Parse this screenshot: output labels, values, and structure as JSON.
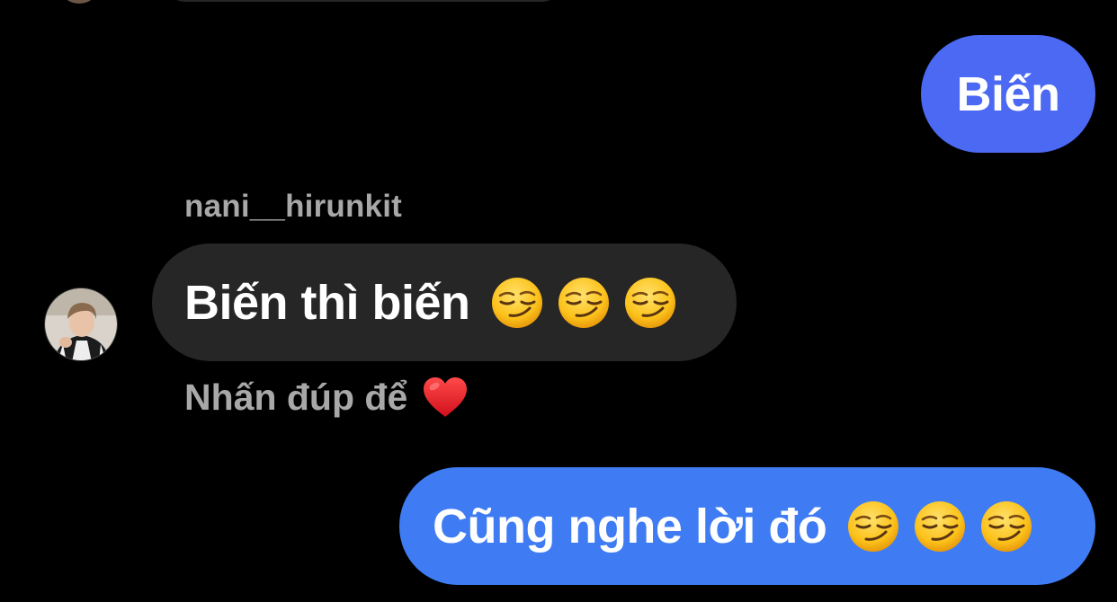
{
  "conversation": {
    "messages": [
      {
        "direction": "outgoing",
        "text": "Biến"
      },
      {
        "direction": "incoming",
        "sender": "nani__hirunkit",
        "text": "Biến thì biến",
        "emojis": [
          "smirking-face",
          "smirking-face",
          "smirking-face"
        ]
      },
      {
        "direction": "outgoing",
        "text": "Cũng nghe lời đó",
        "emojis": [
          "smirking-face",
          "smirking-face",
          "smirking-face"
        ]
      }
    ],
    "double_tap_hint": "Nhấn đúp để",
    "hint_icon": "red-heart-icon"
  },
  "colors": {
    "background": "#000000",
    "outgoing_bubble_1": "#4b69f2",
    "outgoing_bubble_2": "#3f7cf3",
    "incoming_bubble": "#262626",
    "secondary_text": "#a8a8a8"
  }
}
